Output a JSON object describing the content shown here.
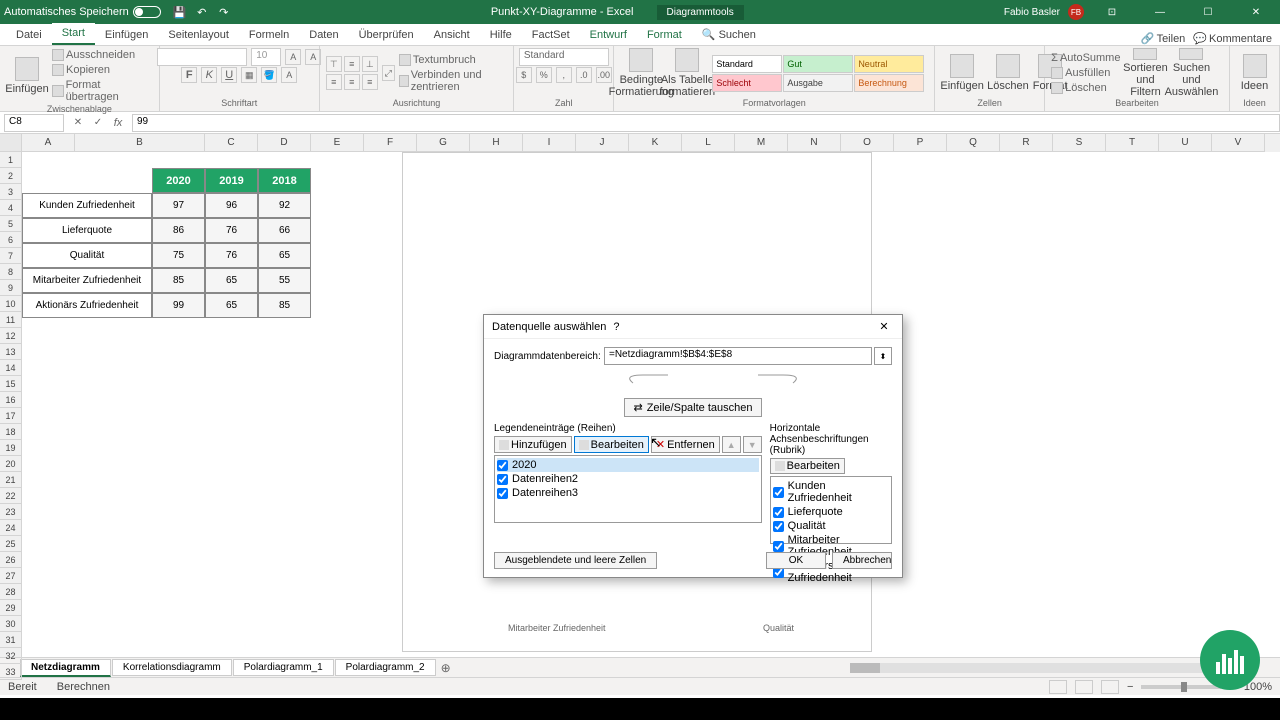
{
  "titlebar": {
    "autosave": "Automatisches Speichern",
    "filename": "Punkt-XY-Diagramme - Excel",
    "tools": "Diagrammtools",
    "user": "Fabio Basler",
    "user_initials": "FB"
  },
  "tabs": {
    "items": [
      "Datei",
      "Start",
      "Einfügen",
      "Seitenlayout",
      "Formeln",
      "Daten",
      "Überprüfen",
      "Ansicht",
      "Hilfe",
      "FactSet",
      "Entwurf",
      "Format"
    ],
    "search": "Suchen",
    "share": "Teilen",
    "comments": "Kommentare"
  },
  "ribbon": {
    "clipboard": {
      "label": "Zwischenablage",
      "paste": "Einfügen",
      "cut": "Ausschneiden",
      "copy": "Kopieren",
      "format": "Format übertragen"
    },
    "font": {
      "label": "Schriftart",
      "size": "10"
    },
    "align": {
      "label": "Ausrichtung",
      "wrap": "Textumbruch",
      "merge": "Verbinden und zentrieren"
    },
    "number": {
      "label": "Zahl",
      "format": "Standard"
    },
    "cond": {
      "label": "Formatvorlagen",
      "cond": "Bedingte\nFormatierung",
      "table": "Als Tabelle\nformatieren"
    },
    "styles": {
      "std": "Standard",
      "gut": "Gut",
      "neu": "Neutral",
      "sch": "Schlecht",
      "aus": "Ausgabe",
      "ber": "Berechnung"
    },
    "cells": {
      "label": "Zellen",
      "ins": "Einfügen",
      "del": "Löschen",
      "fmt": "Format"
    },
    "edit": {
      "label": "Bearbeiten",
      "sum": "AutoSumme",
      "fill": "Ausfüllen",
      "clear": "Löschen",
      "sort": "Sortieren und\nFiltern",
      "find": "Suchen und\nAuswählen"
    },
    "ideas": {
      "label": "Ideen",
      "btn": "Ideen"
    }
  },
  "formula": {
    "cell": "C8",
    "value": "99"
  },
  "columns": [
    "A",
    "B",
    "C",
    "D",
    "E",
    "F",
    "G",
    "H",
    "I",
    "J",
    "K",
    "L",
    "M",
    "N",
    "O",
    "P",
    "Q",
    "R",
    "S",
    "T",
    "U",
    "V"
  ],
  "table": {
    "years": [
      "2020",
      "2019",
      "2018"
    ],
    "rows": [
      {
        "label": "Kunden Zufriedenheit",
        "vals": [
          "97",
          "96",
          "92"
        ]
      },
      {
        "label": "Lieferquote",
        "vals": [
          "86",
          "76",
          "66"
        ]
      },
      {
        "label": "Qualität",
        "vals": [
          "75",
          "76",
          "65"
        ]
      },
      {
        "label": "Mitarbeiter Zufriedenheit",
        "vals": [
          "85",
          "65",
          "55"
        ]
      },
      {
        "label": "Aktionärs Zufriedenheit",
        "vals": [
          "99",
          "65",
          "85"
        ]
      }
    ]
  },
  "chart": {
    "left_label": "Mitarbeiter Zufriedenheit",
    "right_label": "Qualität"
  },
  "dialog": {
    "title": "Datenquelle auswählen",
    "range_label": "Diagrammdatenbereich:",
    "range_value": "=Netzdiagramm!$B$4:$E$8",
    "swap": "Zeile/Spalte tauschen",
    "legend_title": "Legendeneinträge (Reihen)",
    "axis_title": "Horizontale Achsenbeschriftungen (Rubrik)",
    "add": "Hinzufügen",
    "edit": "Bearbeiten",
    "remove": "Entfernen",
    "edit2": "Bearbeiten",
    "series": [
      "2020",
      "Datenreihen2",
      "Datenreihen3"
    ],
    "categories": [
      "Kunden Zufriedenheit",
      "Lieferquote",
      "Qualität",
      "Mitarbeiter Zufriedenheit",
      "Aktionärs Zufriedenheit"
    ],
    "hidden": "Ausgeblendete und leere Zellen",
    "ok": "OK",
    "cancel": "Abbrechen"
  },
  "sheets": {
    "tabs": [
      "Netzdiagramm",
      "Korrelationsdiagramm",
      "Polardiagramm_1",
      "Polardiagramm_2"
    ]
  },
  "status": {
    "ready": "Bereit",
    "calc": "Berechnen",
    "zoom": "100%"
  },
  "chart_data": {
    "type": "radar",
    "categories": [
      "Kunden Zufriedenheit",
      "Lieferquote",
      "Qualität",
      "Mitarbeiter Zufriedenheit",
      "Aktionärs Zufriedenheit"
    ],
    "series": [
      {
        "name": "2020",
        "values": [
          97,
          86,
          75,
          85,
          99
        ]
      },
      {
        "name": "2019",
        "values": [
          96,
          76,
          76,
          65,
          65
        ]
      },
      {
        "name": "2018",
        "values": [
          92,
          66,
          65,
          55,
          85
        ]
      }
    ],
    "title": "",
    "ylim": [
      0,
      100
    ]
  }
}
